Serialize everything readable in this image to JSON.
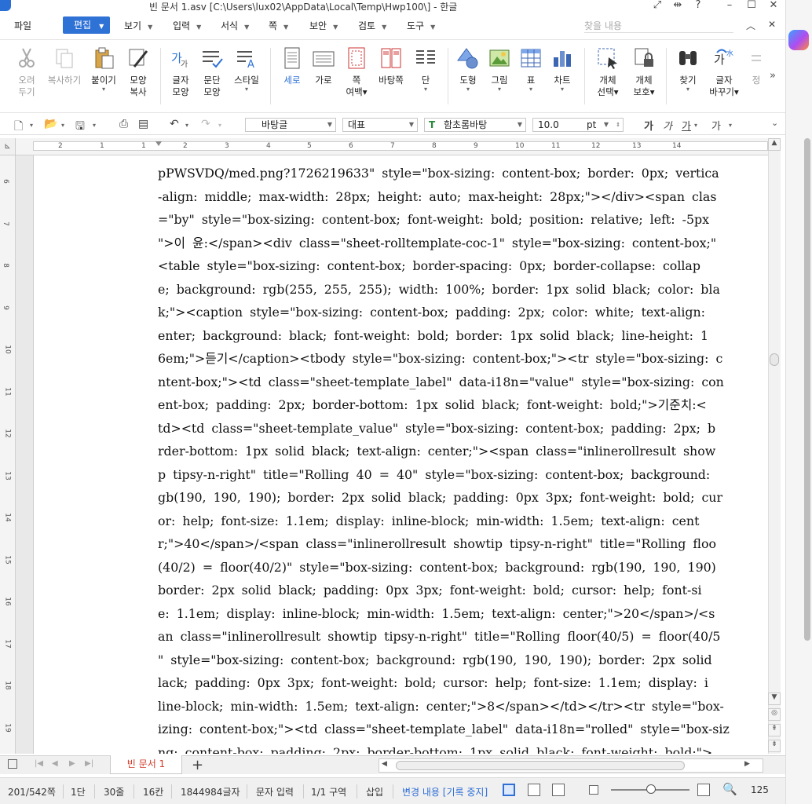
{
  "titlebar": {
    "title": "빈 문서 1.asv [C:\\Users\\lux02\\AppData\\Local\\Temp\\Hwp100\\] - 한글",
    "controls": [
      "⤢",
      "⇹",
      "?",
      "–",
      "☐",
      "✕"
    ]
  },
  "menubar": {
    "items": [
      {
        "label": "파일",
        "dropdown": false
      },
      {
        "label": "편집",
        "dropdown": true,
        "active": true
      },
      {
        "label": "보기",
        "dropdown": true
      },
      {
        "label": "입력",
        "dropdown": true
      },
      {
        "label": "서식",
        "dropdown": true
      },
      {
        "label": "쪽",
        "dropdown": true
      },
      {
        "label": "보안",
        "dropdown": true
      },
      {
        "label": "검토",
        "dropdown": true
      },
      {
        "label": "도구",
        "dropdown": true
      }
    ],
    "search_placeholder": "찾을 내용",
    "collapse_icon": "chevron-up-icon",
    "close_icon": "close-icon"
  },
  "ribbon": {
    "buttons": [
      {
        "line1": "오려",
        "line2": "두기",
        "icon": "scissors-icon",
        "enabled": false
      },
      {
        "line1": "복사하기",
        "line2": "",
        "icon": "copy-icon",
        "enabled": false
      },
      {
        "line1": "붙이기",
        "line2": "▾",
        "icon": "paste-icon",
        "enabled": true
      },
      {
        "line1": "모양",
        "line2": "복사",
        "icon": "format-painter-icon",
        "enabled": true
      },
      {
        "line1": "글자",
        "line2": "모양",
        "icon": "char-shape-icon",
        "enabled": true
      },
      {
        "line1": "문단",
        "line2": "모양",
        "icon": "para-shape-icon",
        "enabled": true
      },
      {
        "line1": "스타일",
        "line2": "▾",
        "icon": "style-icon",
        "enabled": true
      },
      {
        "line1": "세로",
        "line2": "",
        "icon": "portrait-icon",
        "enabled": true,
        "active": true
      },
      {
        "line1": "가로",
        "line2": "",
        "icon": "landscape-icon",
        "enabled": true
      },
      {
        "line1": "쪽",
        "line2": "여백▾",
        "icon": "margin-icon",
        "enabled": true
      },
      {
        "line1": "바탕쪽",
        "line2": "",
        "icon": "master-page-icon",
        "enabled": true
      },
      {
        "line1": "단",
        "line2": "▾",
        "icon": "columns-icon",
        "enabled": true
      },
      {
        "line1": "도형",
        "line2": "▾",
        "icon": "shape-icon",
        "enabled": true
      },
      {
        "line1": "그림",
        "line2": "▾",
        "icon": "picture-icon",
        "enabled": true
      },
      {
        "line1": "표",
        "line2": "▾",
        "icon": "table-icon",
        "enabled": true
      },
      {
        "line1": "차트",
        "line2": "▾",
        "icon": "chart-icon",
        "enabled": true
      },
      {
        "line1": "개체",
        "line2": "선택▾",
        "icon": "object-select-icon",
        "enabled": true
      },
      {
        "line1": "개체",
        "line2": "보호▾",
        "icon": "object-protect-icon",
        "enabled": true
      },
      {
        "line1": "찾기",
        "line2": "▾",
        "icon": "binoculars-icon",
        "enabled": true
      },
      {
        "line1": "글자",
        "line2": "바꾸기▾",
        "icon": "replace-icon",
        "enabled": true
      },
      {
        "line1": "정",
        "line2": "",
        "icon": "more-icon",
        "enabled": false
      }
    ],
    "overflow": "»"
  },
  "toolbar2": {
    "style_value": "바탕글",
    "lang_value": "대표",
    "font_value": "함초롬바탕",
    "size_value": "10.0",
    "size_unit": "pt",
    "format_glyphs": [
      "가",
      "가",
      "가",
      "가"
    ]
  },
  "ruler": {
    "h_numbers": [
      "2",
      "1",
      "1",
      "2",
      "3",
      "4",
      "5",
      "6",
      "7",
      "8",
      "9",
      "10",
      "11",
      "12",
      "13",
      "14"
    ],
    "v_numbers": [
      "6",
      "7",
      "8",
      "9",
      "10",
      "11",
      "12",
      "13",
      "14",
      "15",
      "16",
      "17",
      "18",
      "19"
    ]
  },
  "document": {
    "lines": [
      "pPWSVDQ/med.png?1726219633\" style=\"box-sizing: content-box; border: 0px; vertica",
      "-align: middle; max-width: 28px; height: auto; max-height: 28px;\"></div><span clas",
      "=\"by\" style=\"box-sizing: content-box; font-weight: bold; position: relative; left: -5px",
      "\">이 윤:</span><div class=\"sheet-rolltemplate-coc-1\" style=\"box-sizing: content-box;\"",
      "<table style=\"box-sizing: content-box; border-spacing: 0px; border-collapse: collap",
      "e; background: rgb(255, 255, 255); width: 100%; border: 1px solid black; color: bla",
      "k;\"><caption style=\"box-sizing: content-box; padding: 2px; color: white; text-align:",
      "enter; background: black; font-weight: bold; border: 1px solid black; line-height: 1",
      "6em;\">듣기</caption><tbody style=\"box-sizing: content-box;\"><tr style=\"box-sizing: c",
      "ntent-box;\"><td class=\"sheet-template_label\" data-i18n=\"value\" style=\"box-sizing: con",
      "ent-box; padding: 2px; border-bottom: 1px solid black; font-weight: bold;\">기준치:<",
      "td><td class=\"sheet-template_value\" style=\"box-sizing: content-box; padding: 2px; b",
      "rder-bottom: 1px solid black; text-align: center;\"><span class=\"inlinerollresult show",
      "p tipsy-n-right\" title=\"Rolling 40 = 40\" style=\"box-sizing: content-box; background:",
      "gb(190, 190, 190); border: 2px solid black; padding: 0px 3px; font-weight: bold; cur",
      "or: help; font-size: 1.1em; display: inline-block; min-width: 1.5em; text-align: cent",
      "r;\">40</span>/<span class=\"inlinerollresult showtip tipsy-n-right\" title=\"Rolling floo",
      "(40/2) = floor(40/2)\" style=\"box-sizing: content-box; background: rgb(190, 190, 190)",
      "border: 2px solid black; padding: 0px 3px; font-weight: bold; cursor: help; font-si",
      "e: 1.1em; display: inline-block; min-width: 1.5em; text-align: center;\">20</span>/<s",
      "an class=\"inlinerollresult showtip tipsy-n-right\" title=\"Rolling floor(40/5) = floor(40/5",
      "\" style=\"box-sizing: content-box; background: rgb(190, 190, 190); border: 2px solid",
      "lack; padding: 0px 3px; font-weight: bold; cursor: help; font-size: 1.1em; display: i",
      "line-block; min-width: 1.5em; text-align: center;\">8</span></td></tr><tr style=\"box-",
      "izing: content-box;\"><td class=\"sheet-template_label\" data-i18n=\"rolled\" style=\"box-siz",
      "ng: content-box; padding: 2px; border-bottom: 1px solid black; font-weight: bold;\">"
    ]
  },
  "tabs": {
    "active_label": "빈 문서 1",
    "add_label": "+"
  },
  "statusbar": {
    "page": "201/542쪽",
    "column": "1단",
    "line": "30줄",
    "col": "16칸",
    "chars": "1844984글자",
    "mode": "문자 입력",
    "section": "1/1 구역",
    "insert": "삽입",
    "track_changes": "변경 내용 [기록 중지]",
    "zoom": "125"
  },
  "colors": {
    "accent": "#2f72d6",
    "active_tab_text": "#d23b2a"
  }
}
